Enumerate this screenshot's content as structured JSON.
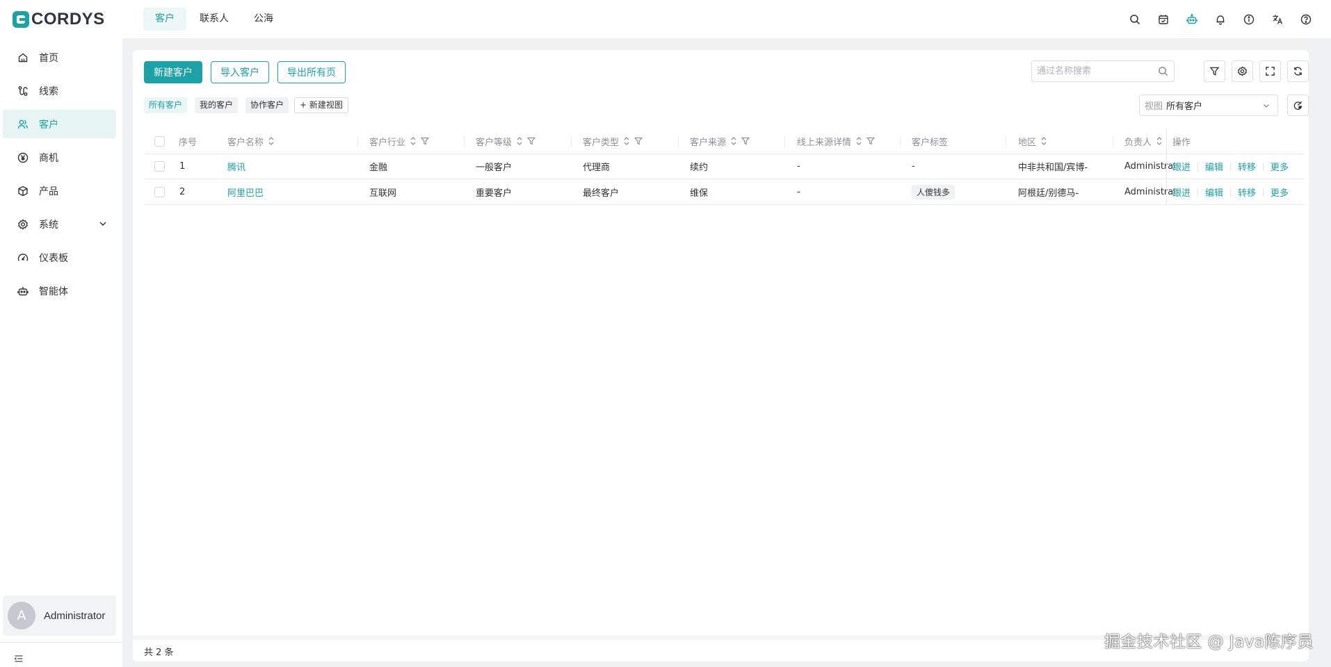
{
  "app": {
    "logo_text": "CORDYS",
    "top_tabs": [
      {
        "label": "客户",
        "active": true
      },
      {
        "label": "联系人",
        "active": false
      },
      {
        "label": "公海",
        "active": false
      }
    ],
    "top_icons": [
      "search-icon",
      "calendar-icon",
      "robot-icon",
      "bell-icon",
      "info-icon",
      "translate-icon",
      "help-icon"
    ]
  },
  "sidebar": {
    "items": [
      {
        "label": "首页",
        "icon": "home-icon",
        "active": false
      },
      {
        "label": "线索",
        "icon": "leads-icon",
        "active": false
      },
      {
        "label": "客户",
        "icon": "users-icon",
        "active": true
      },
      {
        "label": "商机",
        "icon": "yen-icon",
        "active": false
      },
      {
        "label": "产品",
        "icon": "box-icon",
        "active": false
      },
      {
        "label": "系统",
        "icon": "gear-icon",
        "active": false,
        "expandable": true
      },
      {
        "label": "仪表板",
        "icon": "dashboard-icon",
        "active": false
      },
      {
        "label": "智能体",
        "icon": "robot-icon",
        "active": false
      }
    ],
    "user": {
      "avatar_letter": "A",
      "name": "Administrator"
    }
  },
  "toolbar": {
    "new_label": "新建客户",
    "import_label": "导入客户",
    "export_label": "导出所有页",
    "search_placeholder": "通过名称搜索"
  },
  "views": {
    "chips": [
      {
        "label": "所有客户",
        "active": true
      },
      {
        "label": "我的客户",
        "active": false
      },
      {
        "label": "协作客户",
        "active": false
      }
    ],
    "new_view_label": "+ 新建视图",
    "select_label": "视图",
    "select_value": "所有客户"
  },
  "table": {
    "columns": [
      "序号",
      "客户名称",
      "客户行业",
      "客户等级",
      "客户类型",
      "客户来源",
      "线上来源详情",
      "客户标签",
      "地区",
      "负责人",
      "操作"
    ],
    "rows": [
      {
        "index": "1",
        "name": "腾讯",
        "industry": "金融",
        "level": "一般客户",
        "type": "代理商",
        "source": "续约",
        "online_detail": "-",
        "tag": "-",
        "region": "中非共和国/宾博-",
        "owner": "Administrator"
      },
      {
        "index": "2",
        "name": "阿里巴巴",
        "industry": "互联网",
        "level": "重要客户",
        "type": "最终客户",
        "source": "维保",
        "online_detail": "-",
        "tag": "人傻钱多",
        "region": "阿根廷/别德马-",
        "owner": "Administrator"
      }
    ],
    "actions": [
      "跟进",
      "编辑",
      "转移",
      "更多"
    ],
    "total_text": "共 2 条"
  },
  "watermark": "掘金技术社区 @ Java陈序员",
  "colors": {
    "accent": "#1aa2a6",
    "background": "#f0f1f3"
  }
}
